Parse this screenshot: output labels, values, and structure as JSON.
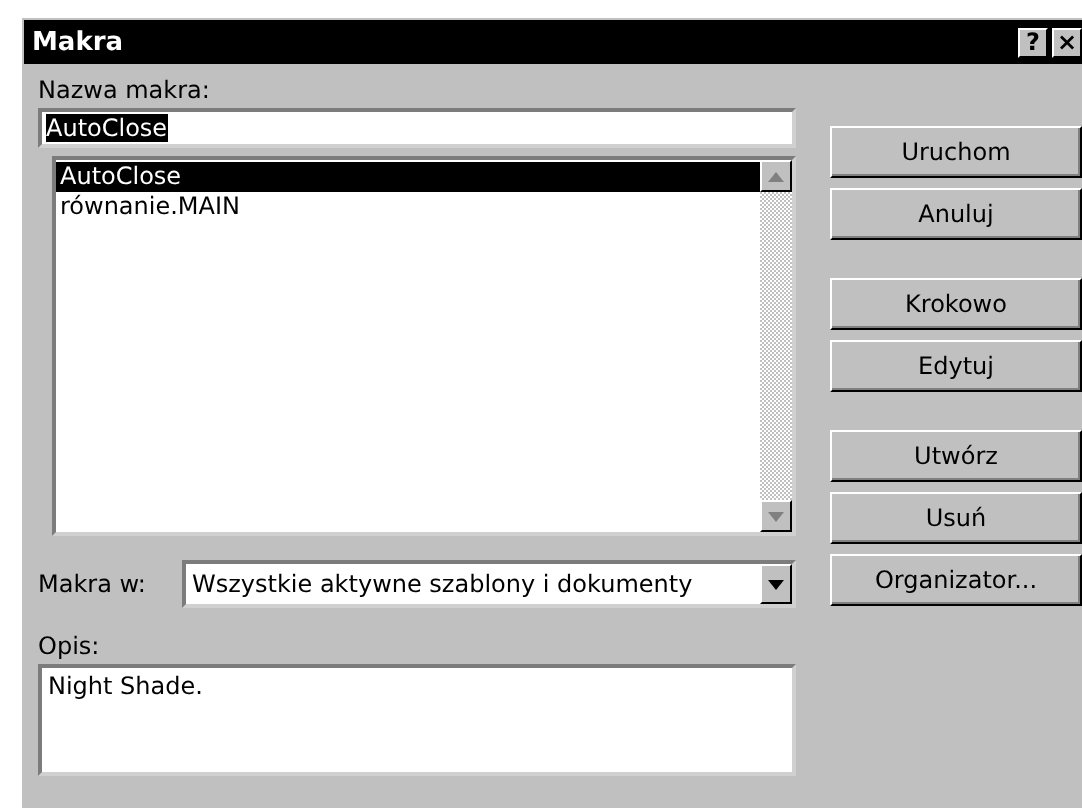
{
  "window": {
    "title": "Makra",
    "help_button": "?",
    "close_button": "×"
  },
  "name_label": "Nazwa makra:",
  "name_field": {
    "value": "AutoClose",
    "selected": true
  },
  "macros": [
    {
      "label": "AutoClose",
      "selected": true
    },
    {
      "label": "równanie.MAIN",
      "selected": false
    }
  ],
  "scope_label": "Makra w:",
  "scope_select": {
    "value": "Wszystkie aktywne szablony i dokumenty"
  },
  "description_label": "Opis:",
  "description": {
    "value": "Night Shade."
  },
  "button_groups": [
    [
      "Uruchom",
      "Anuluj"
    ],
    [
      "Krokowo",
      "Edytuj"
    ],
    [
      "Utwórz",
      "Usuń",
      "Organizator..."
    ]
  ]
}
